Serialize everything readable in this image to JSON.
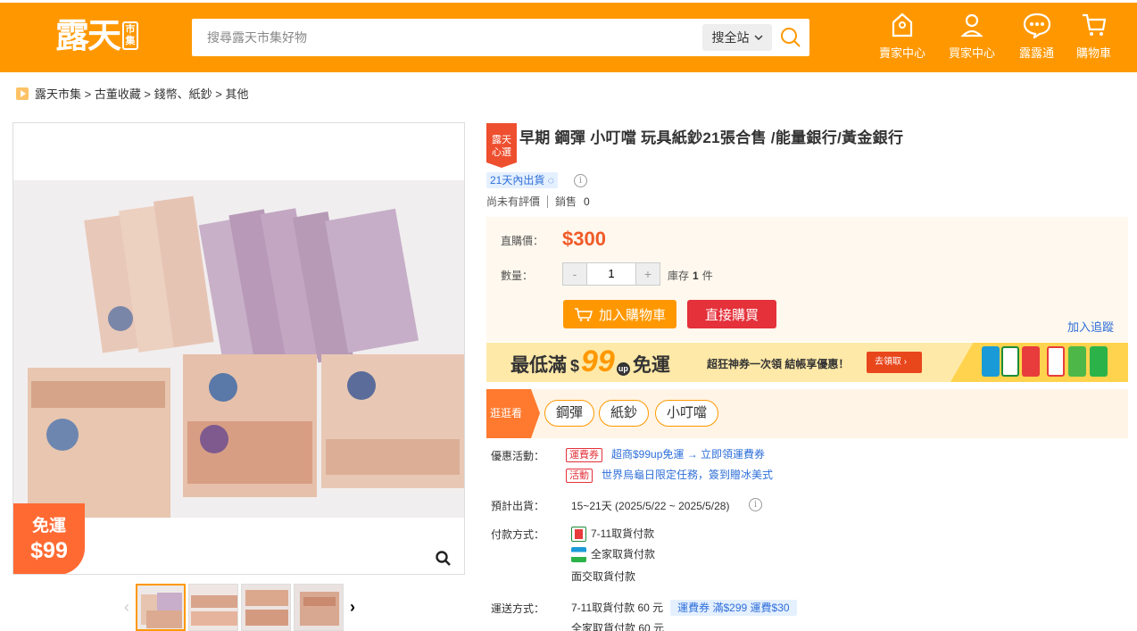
{
  "header": {
    "logo_text": "露天",
    "logo_badge": "市集",
    "search_placeholder": "搜尋露天市集好物",
    "search_scope": "搜全站",
    "nav": [
      {
        "label": "賣家中心",
        "icon": "seller-center-icon"
      },
      {
        "label": "買家中心",
        "icon": "buyer-center-icon"
      },
      {
        "label": "露露通",
        "icon": "chat-icon"
      },
      {
        "label": "購物車",
        "icon": "cart-icon"
      }
    ]
  },
  "breadcrumb": {
    "text": "露天市集 > 古董收藏 > 錢幣、紙鈔 > 其他"
  },
  "gallery": {
    "ship_badge_line1": "免運",
    "ship_badge_line2": "$99"
  },
  "product": {
    "badge_line1": "露天",
    "badge_line2": "心選",
    "title": "早期 鋼彈 小叮噹 玩具紙鈔21張合售 /能量銀行/黃金銀行",
    "ship_tag": "21天內出貨",
    "rating_text": "尚未有評價",
    "sales_label": "銷售",
    "sales_count": "0"
  },
  "buy": {
    "price_label": "直購價：",
    "price": "$300",
    "qty_label": "數量：",
    "qty_minus": "-",
    "qty_value": "1",
    "qty_plus": "+",
    "stock_prefix": "庫存",
    "stock_count": "1",
    "stock_unit": "件",
    "add_cart": "加入購物車",
    "buy_now": "直接購買",
    "track": "加入追蹤"
  },
  "promo": {
    "prefix": "最低滿",
    "dollar": "$",
    "amount": "99",
    "up": "up",
    "suffix": "免運",
    "middle": "超狂神券一次領 結帳享優惠！",
    "claim": "去領取"
  },
  "explore": {
    "label": "逛逛看",
    "chips": [
      "鋼彈",
      "紙鈔",
      "小叮噹"
    ]
  },
  "details": {
    "offers_label": "優惠活動：",
    "offers": [
      {
        "tag": "運費券",
        "text": "超商$99up免運 → 立即領運費券"
      },
      {
        "tag": "活動",
        "text": "世界烏龜日限定任務，簽到贈冰美式"
      }
    ],
    "eta_label": "預計出貨：",
    "eta": "15~21天 (2025/5/22 ~ 2025/5/28)",
    "pay_label": "付款方式：",
    "pay": [
      "7-11取貨付款",
      "全家取貨付款",
      "面交取貨付款"
    ],
    "ship_label": "運送方式：",
    "ship": [
      {
        "text": "7-11取貨付款 60 元",
        "coupon": "運費券 滿$299 運費$30"
      },
      {
        "text": "全家取貨付款 60 元"
      }
    ]
  },
  "colors": {
    "brand": "#ff9800",
    "price": "#f05a28",
    "buy_now": "#e4313a",
    "link": "#2e6fd9"
  }
}
